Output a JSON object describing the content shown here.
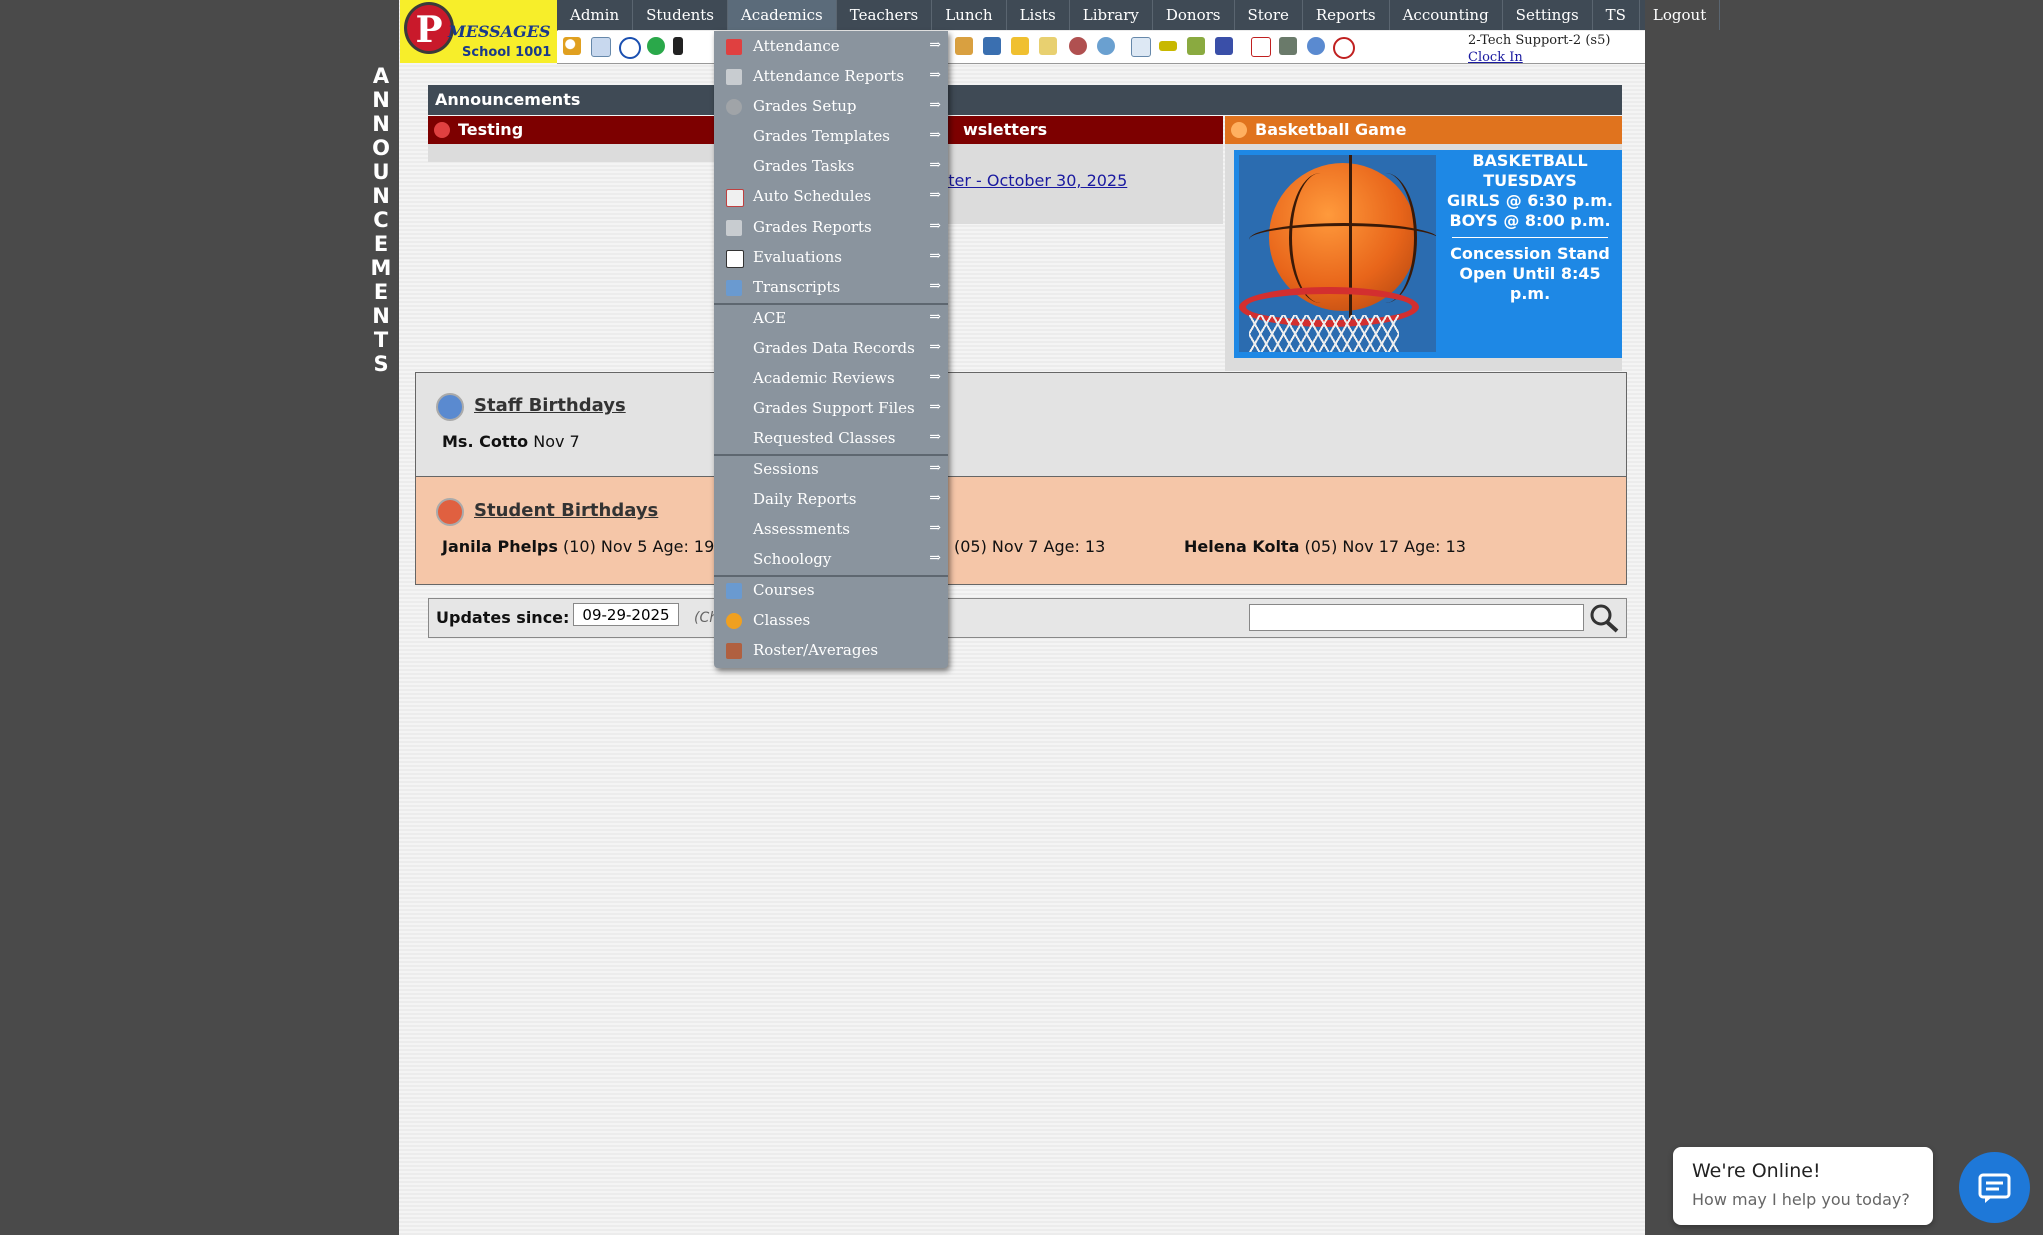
{
  "logo": {
    "letter": "P",
    "name": "MESSAGES",
    "school": "School 1001"
  },
  "nav": [
    "Admin",
    "Students",
    "Academics",
    "Teachers",
    "Lunch",
    "Lists",
    "Library",
    "Donors",
    "Store",
    "Reports",
    "Accounting",
    "Settings",
    "TS",
    "Logout"
  ],
  "nav_active": "Academics",
  "user": {
    "name": "2-Tech Support-2 (s5)",
    "clock_in": "Clock In"
  },
  "side_label": [
    "A",
    "N",
    "N",
    "O",
    "U",
    "N",
    "C",
    "E",
    "M",
    "E",
    "N",
    "T",
    "S"
  ],
  "announcements": {
    "title": "Announcements",
    "testing": "Testing",
    "newsletters": "wsletters",
    "newsletter_link": "tter - October 30, 2025",
    "basketball": {
      "title": "Basketball Game",
      "lines": [
        "BASKETBALL",
        "TUESDAYS",
        "GIRLS @ 6:30 p.m.",
        "BOYS  @ 8:00 p.m."
      ],
      "concession": [
        "Concession Stand",
        "Open Until 8:45 p.m."
      ]
    }
  },
  "staff_birthdays": {
    "title": "Staff Birthdays",
    "name": "Ms. Cotto",
    "date": "Nov 7"
  },
  "student_birthdays": {
    "title": "Student Birthdays",
    "e1_name": "Janila Phelps",
    "e1_rest": "(10) Nov 5 Age: 19",
    "e2_rest": "(05) Nov 7 Age: 13",
    "e3_name": "Helena Kolta",
    "e3_rest": "(05) Nov 17 Age: 13"
  },
  "updates": {
    "label": "Updates since:",
    "date": "09-29-2025",
    "note": "(Ch"
  },
  "menu": {
    "arrow": "⇒",
    "items": [
      "Attendance",
      "Attendance Reports",
      "Grades Setup",
      "Grades Templates",
      "Grades Tasks",
      "Auto Schedules",
      "Grades Reports",
      "Evaluations",
      "Transcripts",
      "ACE",
      "Grades Data Records",
      "Academic Reviews",
      "Grades Support Files",
      "Requested Classes",
      "Sessions",
      "Daily Reports",
      "Assessments",
      "Schoology",
      "Courses",
      "Classes",
      "Roster/Averages"
    ]
  },
  "chat": {
    "title": "We're Online!",
    "subtitle": "How may I help you today?"
  },
  "colors": {
    "nav": "#3f4a55",
    "menu": "#8a949e",
    "dark_red": "#7d0000",
    "orange": "#e0731e",
    "blue": "#1e88e5",
    "logo_yellow": "#f7ee2a"
  }
}
